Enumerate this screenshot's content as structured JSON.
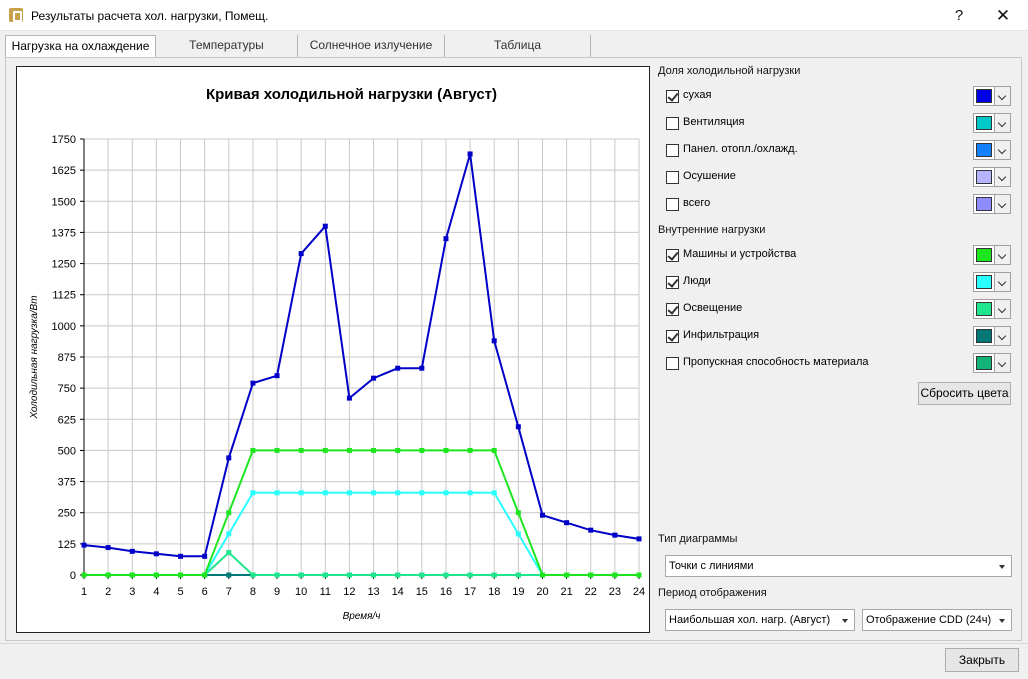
{
  "window": {
    "title": "Результаты расчета хол. нагрузки, Помещ.",
    "help": "?",
    "close": "✕"
  },
  "tabs": [
    {
      "label": "Нагрузка на охлаждение",
      "active": true
    },
    {
      "label": "Температуры",
      "active": false
    },
    {
      "label": "Солнечное излучение",
      "active": false
    },
    {
      "label": "Таблица",
      "active": false
    }
  ],
  "cooling_share": {
    "label": "Доля холодильной нагрузки",
    "items": [
      {
        "label": "сухая",
        "checked": true,
        "color": "#0000e6"
      },
      {
        "label": "Вентиляция",
        "checked": false,
        "color": "#00c8c8"
      },
      {
        "label": "Панел. отопл./охлажд.",
        "checked": false,
        "color": "#1480ff"
      },
      {
        "label": "Осушение",
        "checked": false,
        "color": "#b4b4ff"
      },
      {
        "label": "всего",
        "checked": false,
        "color": "#8c8cff"
      }
    ]
  },
  "internal_loads": {
    "label": "Внутренние нагрузки",
    "items": [
      {
        "label": "Машины и устройства",
        "checked": true,
        "color": "#1ee61e"
      },
      {
        "label": "Люди",
        "checked": true,
        "color": "#28ffff"
      },
      {
        "label": "Освещение",
        "checked": true,
        "color": "#1ee68c"
      },
      {
        "label": "Инфильтрация",
        "checked": true,
        "color": "#007878"
      },
      {
        "label": "Пропускная способность материала",
        "checked": false,
        "color": "#14b478"
      }
    ]
  },
  "reset_colors": "Сбросить цвета",
  "chart_type": {
    "label": "Тип диаграммы",
    "value": "Точки с линиями"
  },
  "display_period": {
    "label": "Период отображения",
    "value1": "Наибольшая хол. нагр. (Август)",
    "value2": "Отображение CDD (24ч)"
  },
  "close_button": "Закрыть",
  "chart_data": {
    "type": "line",
    "title": "Кривая холодильной нагрузки (Август)",
    "xlabel": "Время/ч",
    "ylabel": "Холодильная нагрузка/Вт",
    "x": [
      1,
      2,
      3,
      4,
      5,
      6,
      7,
      8,
      9,
      10,
      11,
      12,
      13,
      14,
      15,
      16,
      17,
      18,
      19,
      20,
      21,
      22,
      23,
      24
    ],
    "xlim": [
      1,
      24
    ],
    "ylim": [
      0,
      1750
    ],
    "yticks": [
      0,
      125,
      250,
      375,
      500,
      625,
      750,
      875,
      1000,
      1125,
      1250,
      1375,
      1500,
      1625,
      1750
    ],
    "grid": true,
    "series": [
      {
        "color": "#0000c8",
        "values": [
          120,
          110,
          95,
          85,
          75,
          75,
          470,
          770,
          800,
          1290,
          1400,
          710,
          790,
          830,
          830,
          1350,
          1690,
          940,
          595,
          240,
          210,
          180,
          160,
          145
        ]
      },
      {
        "color": "#1ee61e",
        "values": [
          0,
          0,
          0,
          0,
          0,
          0,
          250,
          500,
          500,
          500,
          500,
          500,
          500,
          500,
          500,
          500,
          500,
          500,
          250,
          0,
          0,
          0,
          0,
          0
        ]
      },
      {
        "color": "#28ffff",
        "values": [
          0,
          0,
          0,
          0,
          0,
          0,
          165,
          330,
          330,
          330,
          330,
          330,
          330,
          330,
          330,
          330,
          330,
          330,
          165,
          0,
          0,
          0,
          0,
          0
        ]
      },
      {
        "color": "#1ee68c",
        "values": [
          0,
          0,
          0,
          0,
          0,
          0,
          90,
          0,
          0,
          0,
          0,
          0,
          0,
          0,
          0,
          0,
          0,
          0,
          0,
          0,
          0,
          0,
          0,
          0
        ]
      },
      {
        "color": "#007878",
        "values": [
          0,
          0,
          0,
          0,
          0,
          0,
          0,
          0,
          0,
          0,
          0,
          0,
          0,
          0,
          0,
          0,
          0,
          0,
          0,
          0,
          0,
          0,
          0,
          0
        ]
      }
    ]
  }
}
